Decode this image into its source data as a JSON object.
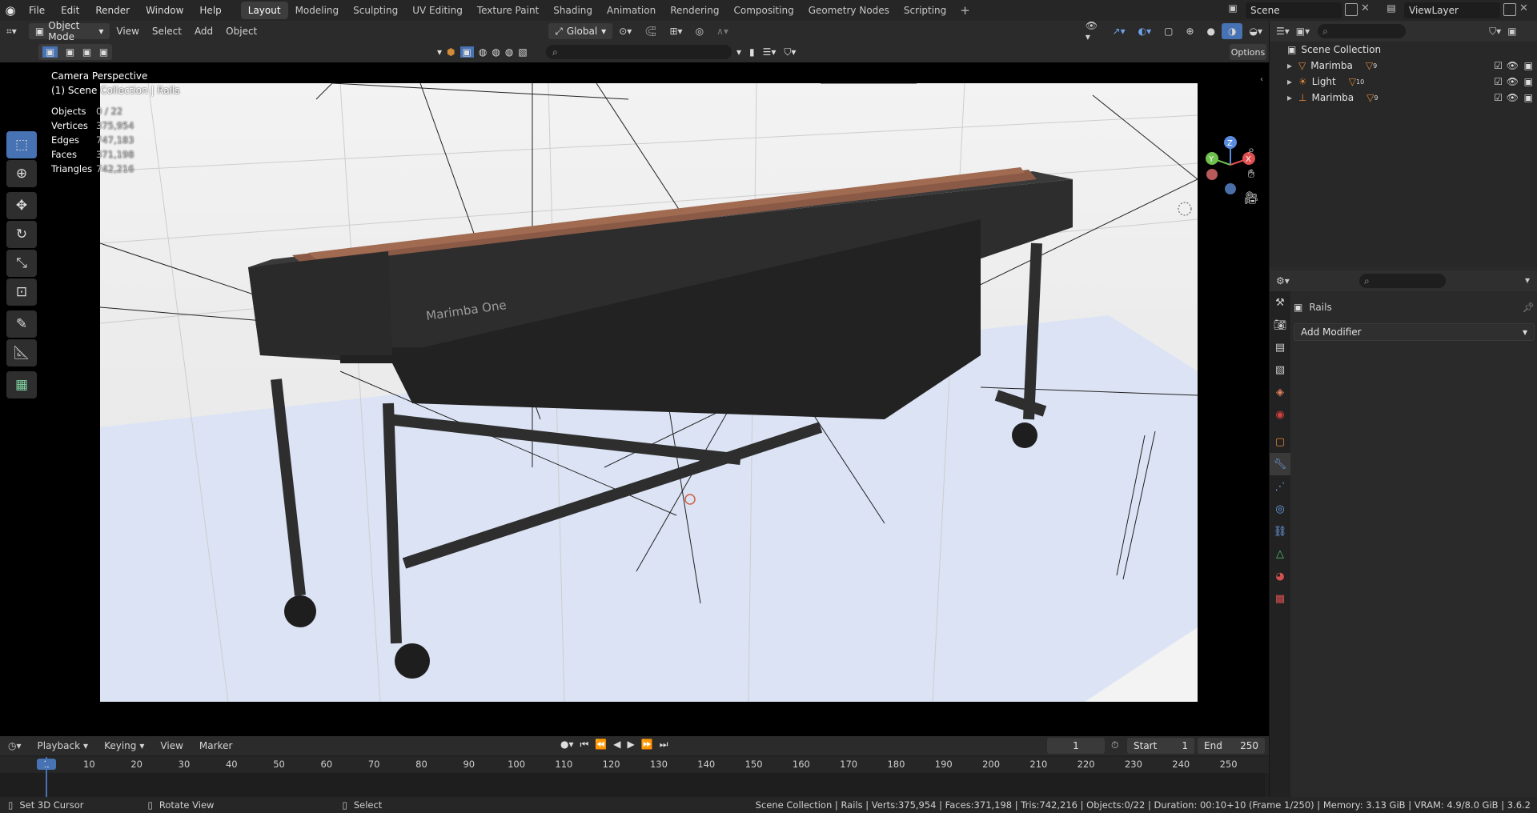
{
  "menu": [
    "File",
    "Edit",
    "Render",
    "Window",
    "Help"
  ],
  "workspaces": [
    "Layout",
    "Modeling",
    "Sculpting",
    "UV Editing",
    "Texture Paint",
    "Shading",
    "Animation",
    "Rendering",
    "Compositing",
    "Geometry Nodes",
    "Scripting"
  ],
  "workspace_plus": "+",
  "scene_name": "Scene",
  "view_layer": "ViewLayer",
  "view_header": {
    "mode": "Object Mode",
    "items": [
      "View",
      "Select",
      "Add",
      "Object"
    ],
    "orientation": "Global",
    "options": "Options"
  },
  "viewport": {
    "title": "Camera Perspective",
    "subtitle": "(1) Scene Collection | Rails",
    "stats": [
      {
        "k": "Objects",
        "v": "0 / 22"
      },
      {
        "k": "Vertices",
        "v": "375,954"
      },
      {
        "k": "Edges",
        "v": "747,183"
      },
      {
        "k": "Faces",
        "v": "371,198"
      },
      {
        "k": "Triangles",
        "v": "742,216"
      }
    ],
    "brand_text": "Marimba One"
  },
  "outliner": {
    "root": "Scene Collection",
    "rows": [
      {
        "name": "Marimba",
        "badge": "9"
      },
      {
        "name": "Light",
        "badge": "10"
      },
      {
        "name": "Marimba",
        "badge": "9"
      }
    ]
  },
  "properties": {
    "object_name": "Rails",
    "add_modifier": "Add Modifier"
  },
  "timeline": {
    "playback": "Playback",
    "keying": "Keying",
    "view": "View",
    "marker": "Marker",
    "current_frame": "1",
    "start_label": "Start",
    "start": "1",
    "end_label": "End",
    "end": "250",
    "ticks": [
      "1",
      "10",
      "20",
      "30",
      "40",
      "50",
      "60",
      "70",
      "80",
      "90",
      "100",
      "110",
      "120",
      "130",
      "140",
      "150",
      "160",
      "170",
      "180",
      "190",
      "200",
      "210",
      "220",
      "230",
      "240",
      "250"
    ]
  },
  "status": {
    "left1": "Set 3D Cursor",
    "left2": "Rotate View",
    "left3": "Select",
    "right": "Scene Collection | Rails | Verts:375,954 | Faces:371,198 | Tris:742,216 | Objects:0/22 | Duration: 00:10+10 (Frame 1/250) | Memory: 3.13 GiB | VRAM: 4.9/8.0 GiB | 3.6.2"
  },
  "colors": {
    "accent": "#4772b3",
    "bar_wood": "#8a5a46",
    "frame_dark": "#2c2c2c"
  }
}
